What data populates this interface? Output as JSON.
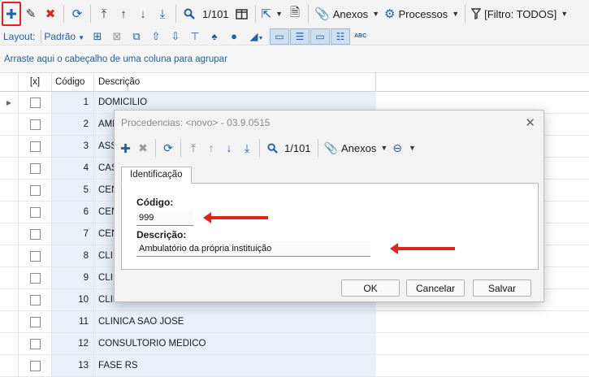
{
  "toolbar": {
    "counter": "1/101",
    "anexos_label": "Anexos",
    "processos_label": "Processos",
    "filter_label": "[Filtro: TODOS]"
  },
  "toolbar2": {
    "layout_label": "Layout:",
    "layout_value": "Padrão",
    "abc_label": "ABC"
  },
  "group_panel": {
    "hint": "Arraste aqui o cabeçalho de uma coluna para agrupar"
  },
  "grid": {
    "headers": {
      "select": "[x]",
      "code": "Código",
      "desc": "Descrição"
    },
    "rows": [
      {
        "code": "1",
        "desc": "DOMICILIO"
      },
      {
        "code": "2",
        "desc": "AMB"
      },
      {
        "code": "3",
        "desc": "ASS"
      },
      {
        "code": "4",
        "desc": "CAS"
      },
      {
        "code": "5",
        "desc": "CEN"
      },
      {
        "code": "6",
        "desc": "CEN"
      },
      {
        "code": "7",
        "desc": "CEN"
      },
      {
        "code": "8",
        "desc": "CLI"
      },
      {
        "code": "9",
        "desc": "CLI"
      },
      {
        "code": "10",
        "desc": "CLINICA POR DO SOL"
      },
      {
        "code": "11",
        "desc": "CLINICA SAO JOSE"
      },
      {
        "code": "12",
        "desc": "CONSULTORIO MEDICO"
      },
      {
        "code": "13",
        "desc": "FASE RS"
      }
    ]
  },
  "dialog": {
    "title": "Procedencias: <novo> - 03.9.0515",
    "counter": "1/101",
    "anexos_label": "Anexos",
    "tab_label": "Identificação",
    "codigo_label": "Código:",
    "codigo_value": "999",
    "descricao_label": "Descrição:",
    "descricao_value": "Ambulatório da própria instituição",
    "ok_label": "OK",
    "cancel_label": "Cancelar",
    "save_label": "Salvar"
  },
  "colors": {
    "accent": "#1f5fa8",
    "highlight": "#e0241b",
    "row_bg": "#e9f0f8"
  }
}
